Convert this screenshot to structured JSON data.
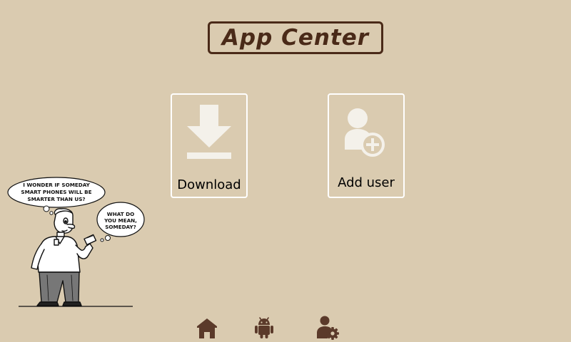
{
  "header": {
    "title": "App Center"
  },
  "tiles": [
    {
      "label": "Download",
      "icon": "download-icon"
    },
    {
      "label": "Add user",
      "icon": "add-user-icon"
    }
  ],
  "cartoon": {
    "bubble_1_lines": [
      "I WONDER IF SOMEDAY",
      "SMART PHONES WILL BE",
      "SMARTER THAN US?"
    ],
    "bubble_2_lines": [
      "WHAT DO",
      "YOU MEAN,",
      "SOMEDAY?"
    ]
  },
  "bottom_nav": [
    {
      "icon": "home-icon"
    },
    {
      "icon": "android-icon"
    },
    {
      "icon": "user-settings-icon"
    }
  ],
  "colors": {
    "background": "#dacbb0",
    "title_text": "#4a2a18",
    "title_border": "#4a2a18",
    "tile_border": "#ffffff",
    "tile_icon": "#f4f1ea",
    "nav_icon": "#5b3a2a",
    "label_text": "#000000"
  }
}
